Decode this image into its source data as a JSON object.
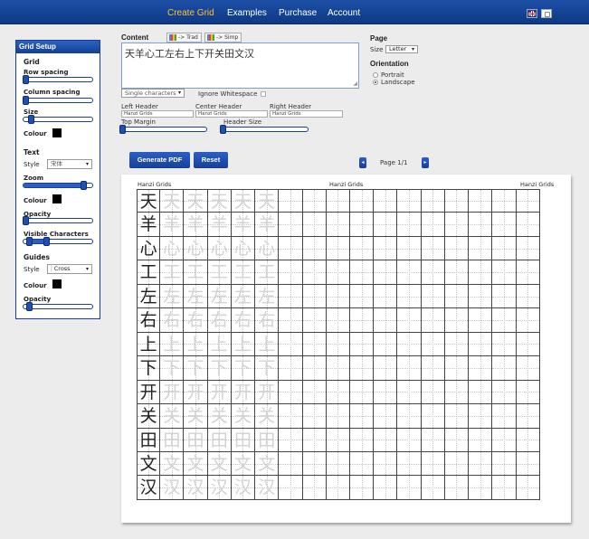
{
  "nav": {
    "items": [
      {
        "label": "Create Grid",
        "active": true
      },
      {
        "label": "Examples",
        "active": false
      },
      {
        "label": "Purchase",
        "active": false
      },
      {
        "label": "Account",
        "active": false
      }
    ],
    "flags": [
      "uk-flag-icon",
      "china-flag-icon"
    ]
  },
  "sidebar": {
    "title": "Grid Setup",
    "grid_heading": "Grid",
    "row_spacing_label": "Row spacing",
    "column_spacing_label": "Column spacing",
    "size_label": "Size",
    "grid_colour_label": "Colour",
    "text_heading": "Text",
    "style_label": "Style",
    "text_style_value": "宋体",
    "zoom_label": "Zoom",
    "text_colour_label": "Colour",
    "opacity_label": "Opacity",
    "visible_chars_label": "Visible Characters",
    "guides_heading": "Guides",
    "guides_style_label": "Style",
    "guides_style_value": "Cross",
    "guides_colour_label": "Colour",
    "guides_opacity_label": "Opacity",
    "values": {
      "row_spacing": 0.0,
      "column_spacing": 0.0,
      "size": 0.1,
      "zoom": 0.85,
      "opacity": 0.0,
      "visible_chars_min": 0.05,
      "visible_chars_max": 0.3,
      "guides_opacity": 0.05
    },
    "colours": {
      "grid": "#000000",
      "text": "#000000",
      "guides": "#000000"
    }
  },
  "content": {
    "label": "Content",
    "trad_button": "-> Trad",
    "simp_button": "-> Simp",
    "text": "天羊心工左右上下开关田文汉",
    "mode_select": "Single characters",
    "ignore_whitespace_label": "Ignore Whitespace",
    "ignore_whitespace": false,
    "left_header_label": "Left Header",
    "left_header_value": "Hanzi Grids",
    "center_header_label": "Center Header",
    "center_header_value": "Hanzi Grids",
    "right_header_label": "Right Header",
    "right_header_value": "Hanzi Grids",
    "top_margin_label": "Top Margin",
    "header_size_label": "Header Size",
    "top_margin_value": 0.0,
    "header_size_value": 0.0
  },
  "page": {
    "heading": "Page",
    "size_label": "Size",
    "size_value": "Letter",
    "orientation_heading": "Orientation",
    "portrait_label": "Portrait",
    "landscape_label": "Landscape",
    "orientation_value": "Landscape"
  },
  "actions": {
    "generate_pdf": "Generate PDF",
    "reset": "Reset",
    "prev": "◂",
    "next": "▸",
    "page_indicator": "Page 1/1"
  },
  "preview": {
    "left_header": "Hanzi Grids",
    "center_header": "Hanzi Grids",
    "right_header": "Hanzi Grids",
    "characters": [
      "天",
      "羊",
      "心",
      "工",
      "左",
      "右",
      "上",
      "下",
      "开",
      "关",
      "田",
      "文",
      "汉"
    ],
    "trace_count": 5,
    "columns": 17
  }
}
